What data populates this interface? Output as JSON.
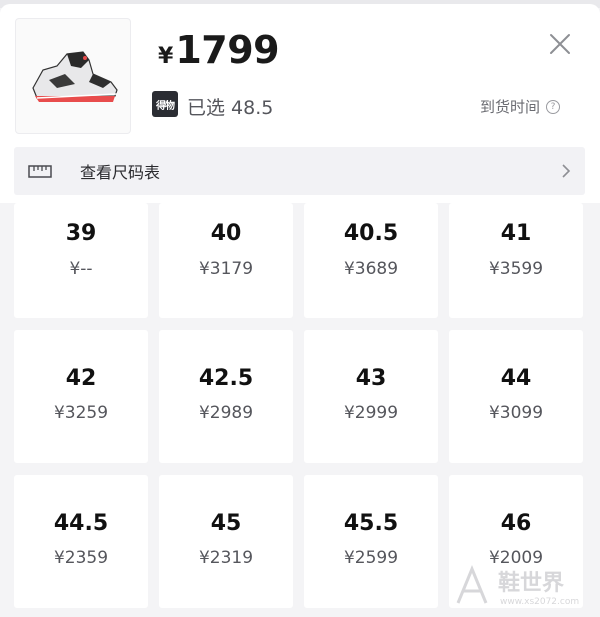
{
  "product": {
    "currency": "¥",
    "price": "1799",
    "badge_text": "得物",
    "selected_text": "已选 48.5",
    "arrival_label": "到货时间",
    "help_glyph": "?"
  },
  "size_chart": {
    "label": "查看尺码表"
  },
  "colors": {
    "accent": "#e84c4c",
    "cell_bg": "#ffffff",
    "page_bg": "#f4f4f6"
  },
  "sizes": [
    {
      "size": "39",
      "price": "¥--"
    },
    {
      "size": "40",
      "price": "¥3179"
    },
    {
      "size": "40.5",
      "price": "¥3689"
    },
    {
      "size": "41",
      "price": "¥3599"
    },
    {
      "size": "42",
      "price": "¥3259"
    },
    {
      "size": "42.5",
      "price": "¥2989"
    },
    {
      "size": "43",
      "price": "¥2999"
    },
    {
      "size": "44",
      "price": "¥3099"
    },
    {
      "size": "44.5",
      "price": "¥2359"
    },
    {
      "size": "45",
      "price": "¥2319"
    },
    {
      "size": "45.5",
      "price": "¥2599"
    },
    {
      "size": "46",
      "price": "¥2009"
    }
  ],
  "watermark": {
    "text": "鞋世界",
    "url": "www.xs2072.com"
  }
}
